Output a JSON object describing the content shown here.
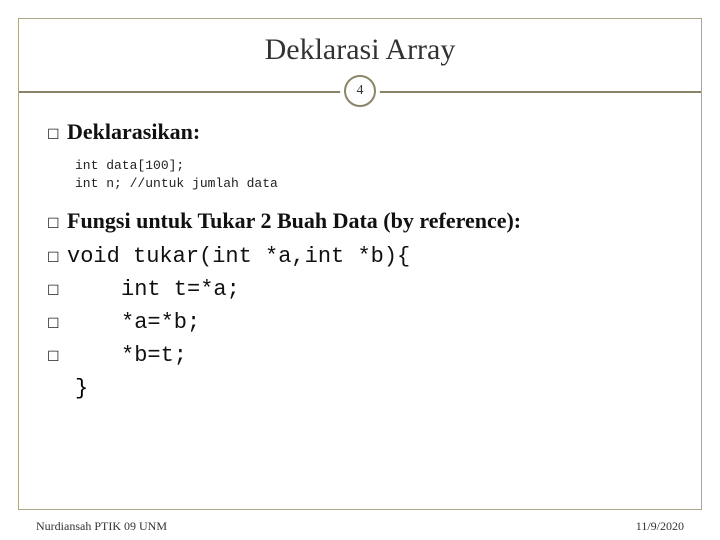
{
  "title": "Deklarasi Array",
  "page_number": "4",
  "section1": {
    "heading": "Deklarasikan:",
    "code": "int data[100];\nint n; //untuk jumlah data"
  },
  "section2": {
    "heading": "Fungsi untuk Tukar 2 Buah Data (by reference):",
    "lines": {
      "l0": "void tukar(int *a,int *b){",
      "l1": "int t=*a;",
      "l2": "*a=*b;",
      "l3": "*b=t;"
    },
    "close": "}"
  },
  "footer": {
    "left": "Nurdiansah PTIK 09 UNM",
    "right": "11/9/2020"
  },
  "glyphs": {
    "bullet": "☐"
  }
}
